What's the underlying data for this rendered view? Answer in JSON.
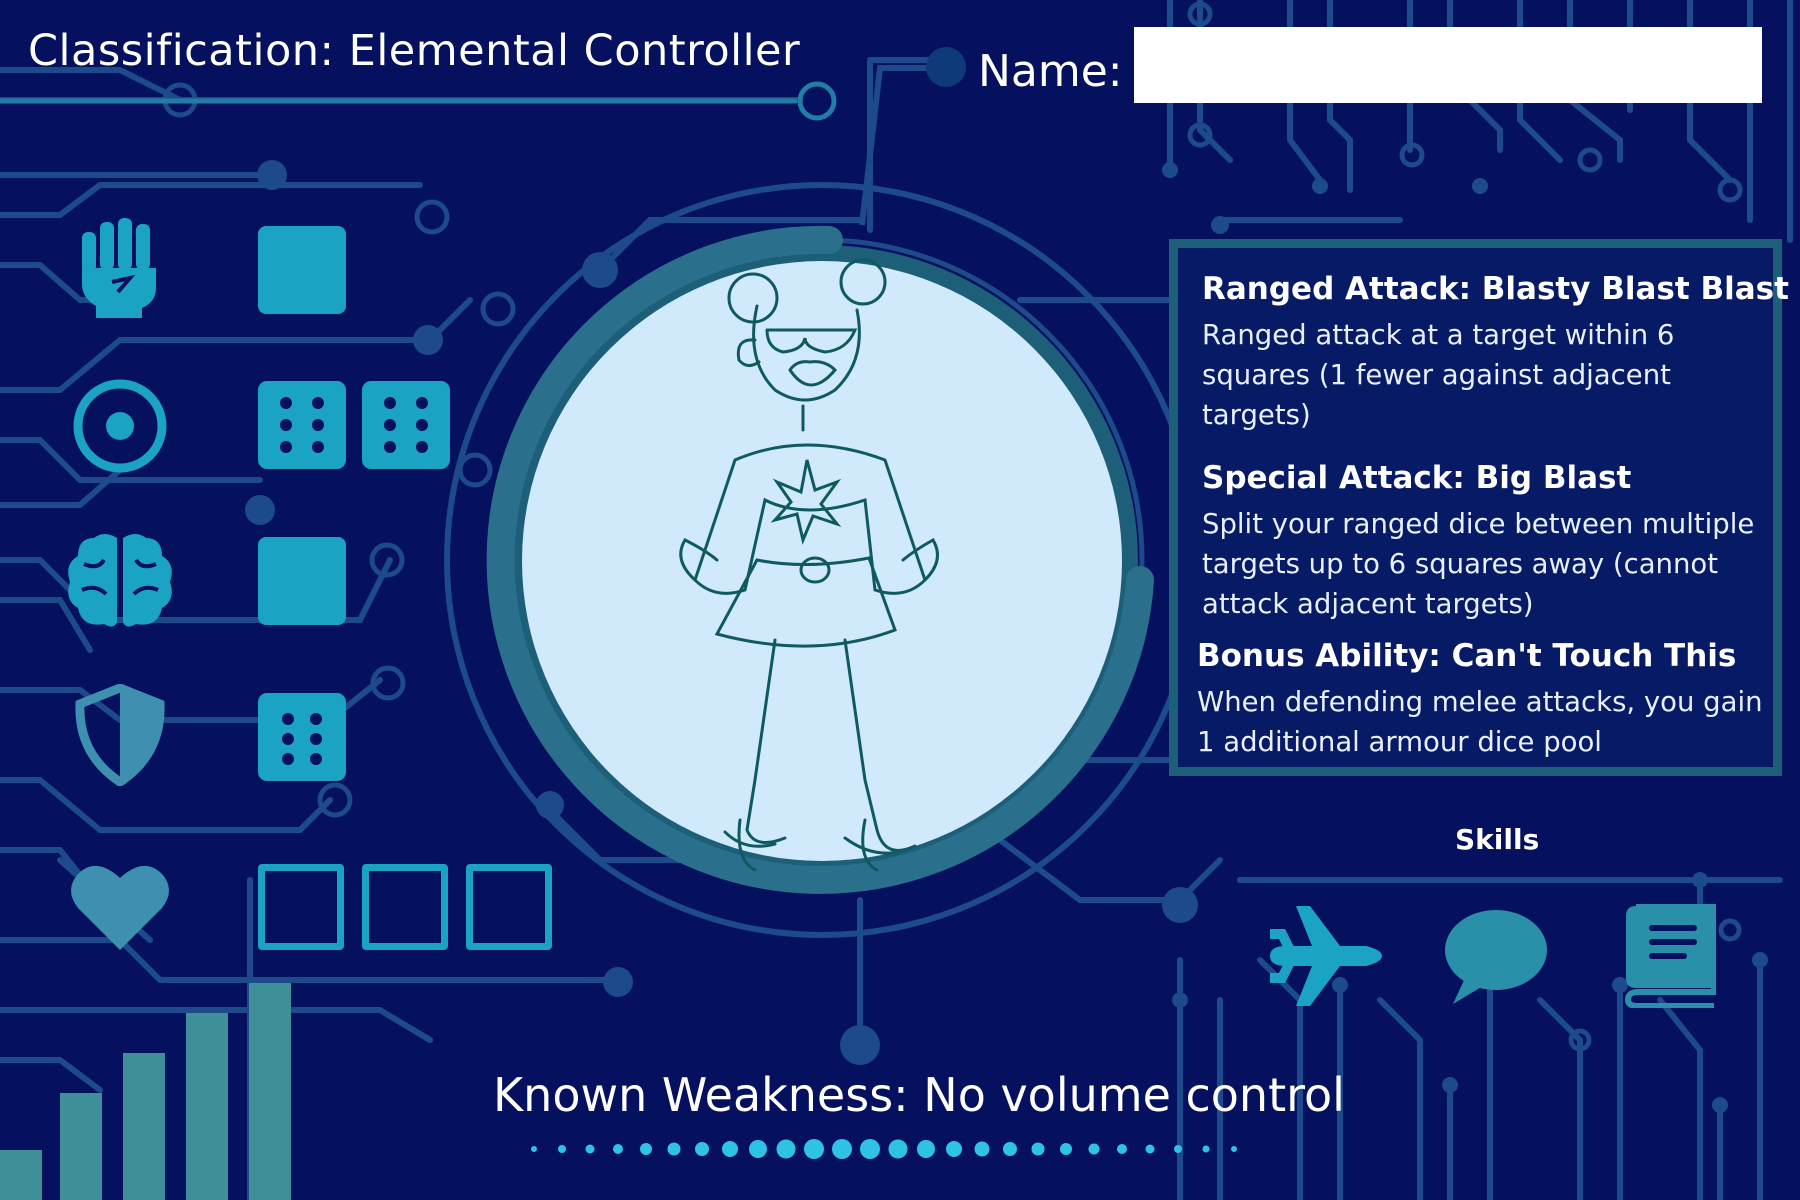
{
  "header": {
    "classification": "Classification: Elemental Controller",
    "name_label": "Name:",
    "name_value": ""
  },
  "stats": [
    {
      "icon": "fist-icon",
      "type": "dice-block",
      "dice_pips": [
        0
      ]
    },
    {
      "icon": "target-icon",
      "type": "dice-block",
      "dice_pips": [
        6,
        6
      ]
    },
    {
      "icon": "brain-icon",
      "type": "dice-block",
      "dice_pips": [
        0
      ]
    },
    {
      "icon": "shield-icon",
      "type": "dice-block",
      "dice_pips": [
        4
      ]
    },
    {
      "icon": "heart-icon",
      "type": "empty-boxes",
      "count": 3
    }
  ],
  "abilities": [
    {
      "title": "Ranged Attack: Blasty Blast Blast",
      "text": "Ranged attack at a target within 6 squares (1 fewer against adjacent targets)"
    },
    {
      "title": "Special Attack: Big Blast",
      "text": "Split your ranged dice between multiple targets up to 6 squares away (cannot attack adjacent targets)"
    },
    {
      "title": "Bonus Ability: Can't Touch This",
      "text": "When defending melee attacks, you gain 1 additional armour dice pool"
    }
  ],
  "skills": {
    "title": "Skills",
    "icons": [
      "airplane-icon",
      "speech-bubble-icon",
      "book-icon"
    ]
  },
  "weakness": "Known Weakness: No volume control",
  "colors": {
    "background": "#05115e",
    "circuit": "#1d4f86",
    "accent": "#1aa3c3",
    "portrait_bg": "#d0e9fb",
    "ring": "#2a6f8c",
    "bars": "#3f8f99"
  }
}
